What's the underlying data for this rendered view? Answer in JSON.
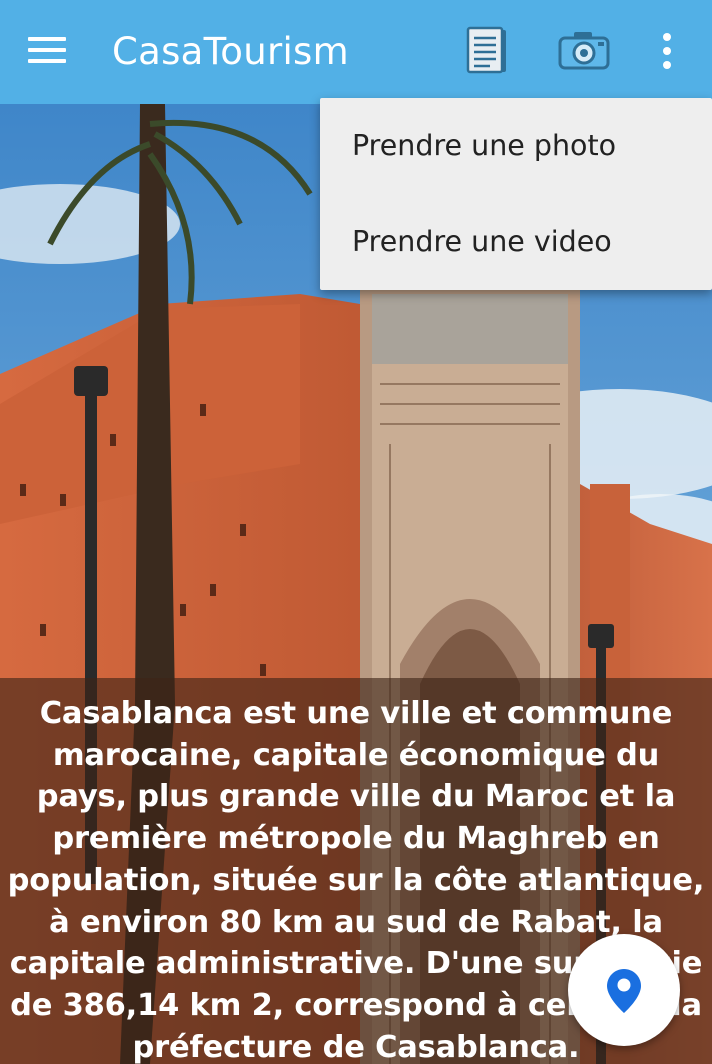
{
  "app": {
    "title": "CasaTourism"
  },
  "toolbar": {
    "menu_icon": "hamburger-menu-icon",
    "doc_icon": "document-icon",
    "camera_icon": "camera-icon",
    "more_icon": "more-vert-icon"
  },
  "overflow_menu": {
    "items": [
      {
        "label": "Prendre une photo"
      },
      {
        "label": "Prendre une video"
      }
    ]
  },
  "hero": {
    "description": "Casablanca est une ville et commune marocaine, capitale économique du pays, plus grande ville du Maroc et la première métropole du Maghreb en population, située sur la côte atlantique, à environ 80 km au sud de Rabat, la capitale administrative. D'une superficie de 386,14 km 2, correspond à celui de la préfecture de Casablanca."
  },
  "fab": {
    "icon": "location-pin-icon"
  },
  "colors": {
    "appbar": "#52b0e6",
    "menu_bg": "#eeeeee",
    "pin": "#1a6fe0",
    "wall": "#c8603a"
  }
}
